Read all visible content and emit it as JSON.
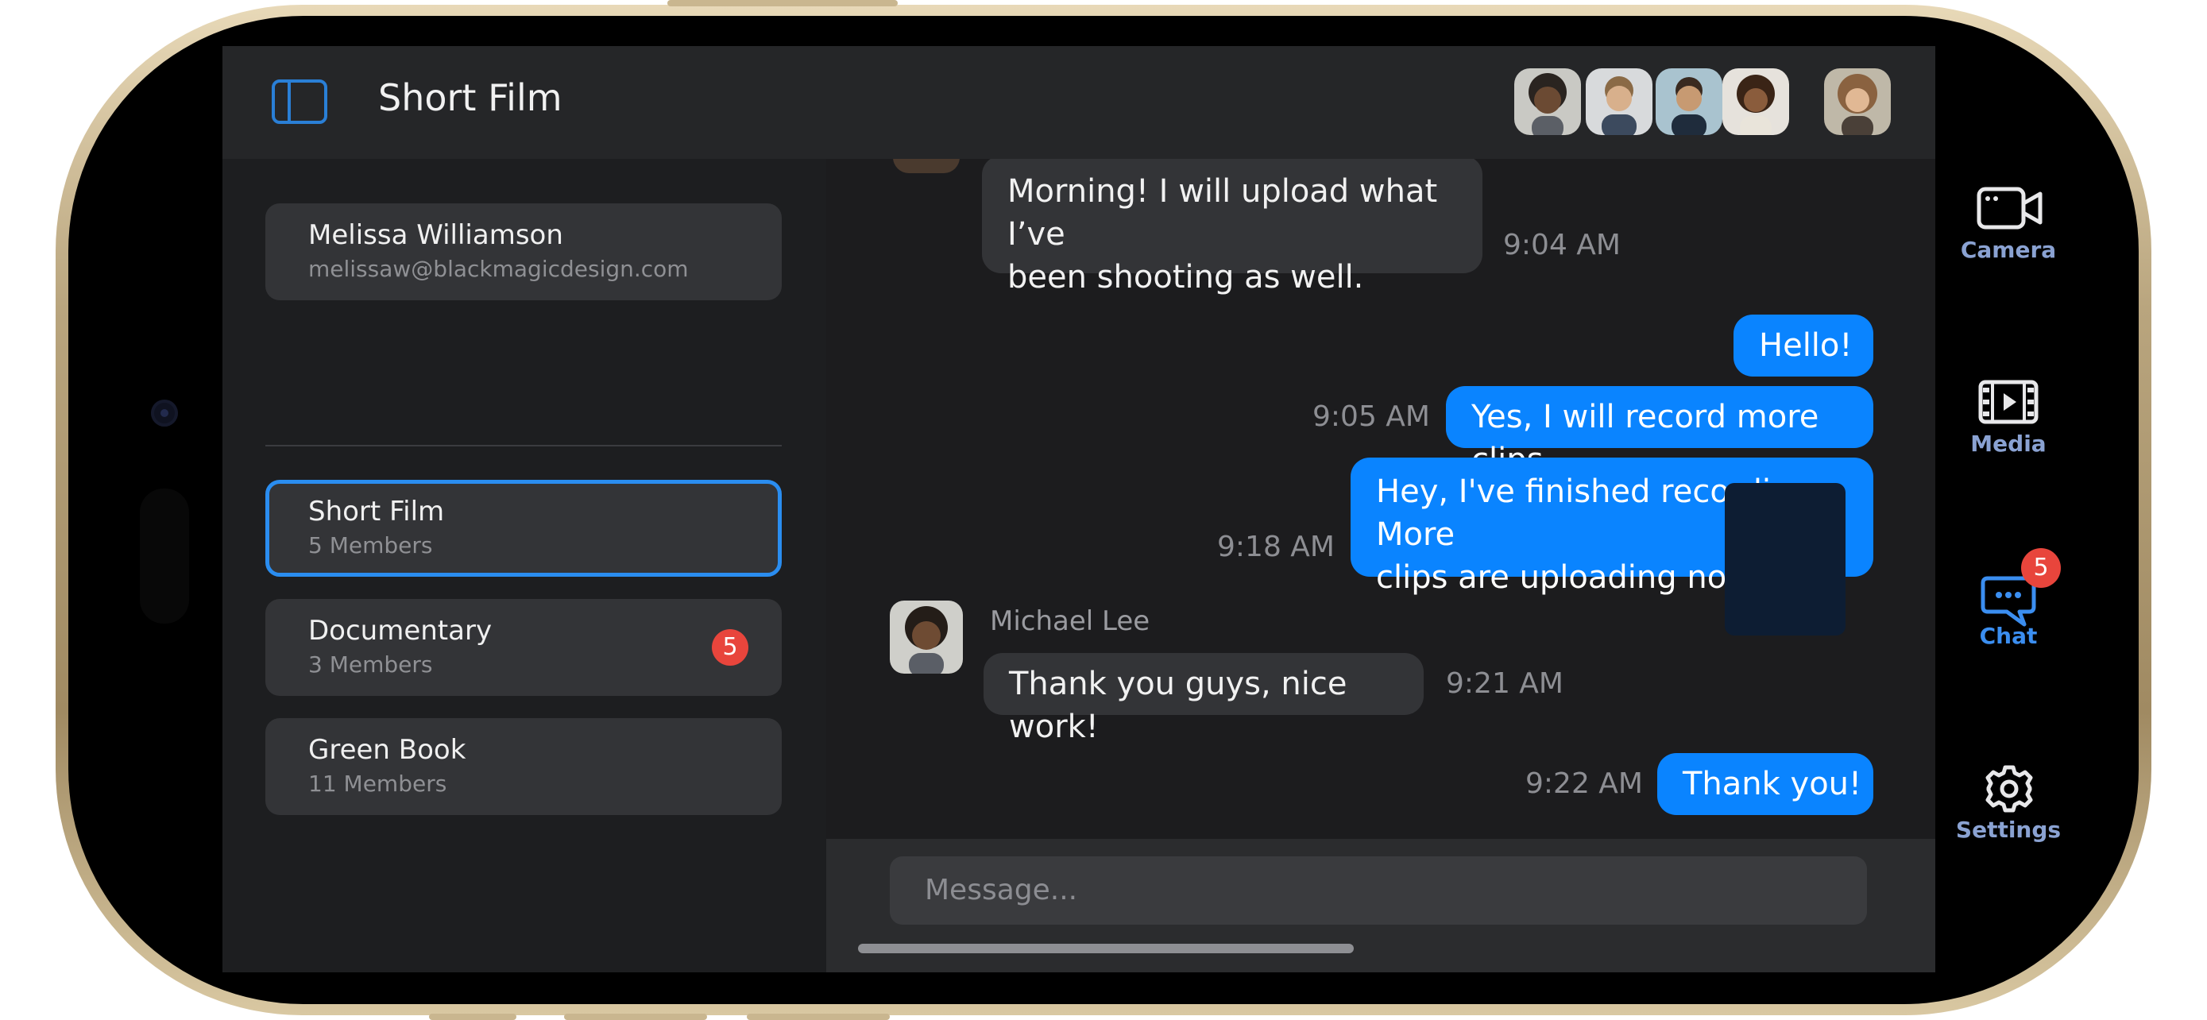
{
  "header": {
    "title": "Short Film"
  },
  "user": {
    "name": "Melissa Williamson",
    "email": "melissaw@blackmagicdesign.com"
  },
  "channels": [
    {
      "name": "Short Film",
      "members": "5 Members",
      "selected": true
    },
    {
      "name": "Documentary",
      "members": "3 Members",
      "unread": "5"
    },
    {
      "name": "Green Book",
      "members": "11 Members"
    }
  ],
  "messages": [
    {
      "text_line1": "Morning! I will upload what I’ve",
      "text_line2": "been shooting as well.",
      "time": "9:04 AM"
    },
    {
      "text": "Hello!"
    },
    {
      "text": "Yes, I will record more clips",
      "time": "9:05 AM"
    },
    {
      "text_line1": "Hey, I've finished recording. More",
      "text_line2": "clips are uploading now",
      "time": "9:18 AM"
    },
    {
      "sender": "Michael Lee",
      "text": "Thank you guys, nice work!",
      "time": "9:21 AM"
    },
    {
      "text": "Thank you!",
      "time": "9:22 AM"
    }
  ],
  "composer": {
    "placeholder": "Message..."
  },
  "nav": {
    "camera": "Camera",
    "media": "Media",
    "chat": "Chat",
    "chat_badge": "5",
    "settings": "Settings"
  },
  "colors": {
    "accent": "#0a84ff",
    "badge": "#e8453c",
    "nav_label": "#8aa2d2"
  }
}
